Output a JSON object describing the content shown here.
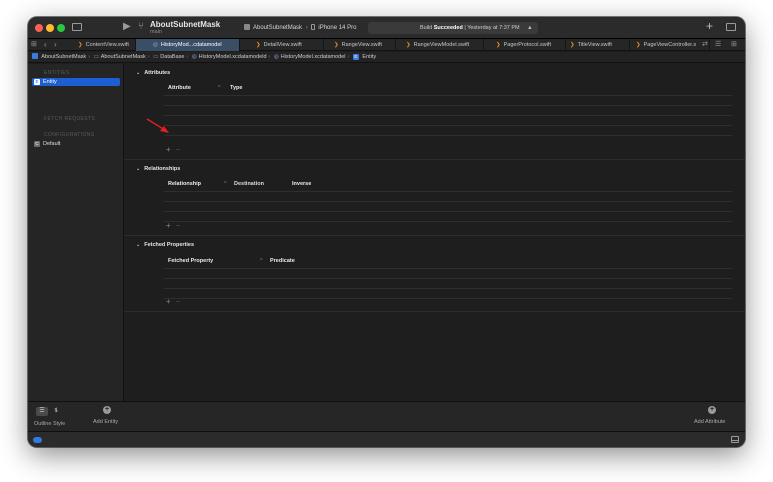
{
  "window": {
    "project_name": "AboutSubnetMask",
    "branch": "main",
    "scheme": "AboutSubnetMask",
    "device": "iPhone 14 Pro",
    "build_status_prefix": "Build",
    "build_status_bold": "Succeeded",
    "build_status_time": "| Yesterday at 7:37 PM"
  },
  "tabs": [
    {
      "label": "ContentView.swift",
      "icon": "swift-file-icon",
      "active": false
    },
    {
      "label": "HistoryMod...cdatamodel",
      "icon": "data-model-icon",
      "active": true
    },
    {
      "label": "DetailView.swift",
      "icon": "swift-file-icon",
      "active": false
    },
    {
      "label": "RangeView.swift",
      "icon": "swift-file-icon",
      "active": false
    },
    {
      "label": "RangeViewModel.swift",
      "icon": "swift-file-icon",
      "active": false
    },
    {
      "label": "PagerProtocol.swift",
      "icon": "swift-file-icon",
      "active": false
    },
    {
      "label": "TitleView.swift",
      "icon": "swift-file-icon",
      "active": false
    },
    {
      "label": "PageViewController.s",
      "icon": "swift-file-icon",
      "active": false
    }
  ],
  "jumpbar": [
    {
      "label": "AboutSubnetMask"
    },
    {
      "label": "AboutSubnetMask"
    },
    {
      "label": "DataBase"
    },
    {
      "label": "HistoryModel.xcdatamodeld"
    },
    {
      "label": "HistoryModel.xcdatamodel"
    },
    {
      "label": "Entity"
    }
  ],
  "sidebar": {
    "entities_header": "ENTITIES",
    "entity_item": "Entity",
    "entity_badge": "E",
    "fetch_requests_header": "FETCH REQUESTS",
    "configurations_header": "CONFIGURATIONS",
    "config_item": "Default",
    "config_badge": "C"
  },
  "attributes": {
    "title": "Attributes",
    "col_attribute": "Attribute",
    "col_type": "Type"
  },
  "relationships": {
    "title": "Relationships",
    "col_relationship": "Relationship",
    "col_destination": "Destination",
    "col_inverse": "Inverse"
  },
  "fetched": {
    "title": "Fetched Properties",
    "col_property": "Fetched Property",
    "col_predicate": "Predicate"
  },
  "bottom": {
    "outline_style": "Outline Style",
    "add_entity": "Add Entity",
    "add_attribute": "Add Attribute"
  },
  "glyphs": {
    "plus": "+",
    "minus": "−",
    "chevron_down": "⌄",
    "sort": "^"
  },
  "colors": {
    "accent": "#1d5fd3",
    "swift": "#f08a24",
    "annotation_arrow": "#e02020"
  }
}
